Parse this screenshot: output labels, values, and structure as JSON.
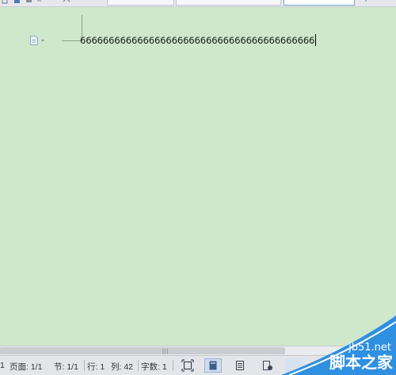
{
  "document": {
    "text": "66666666666666666666666666666666666666666"
  },
  "statusbar": {
    "page_number": "1",
    "page": "页面: 1/1",
    "section": "节: 1/1",
    "line": "行: 1",
    "column": "列: 42",
    "word_count": "字数: 1"
  },
  "watermark": {
    "site": "jb51.net",
    "name": "脚本之家"
  },
  "colors": {
    "page_background": "#cfe8cc",
    "status_bar": "#e3e5e8",
    "watermark_blue": "#2f8fe0"
  },
  "icons": {
    "paragraph": "paste-doc-icon",
    "full-screen": "full-screen-icon",
    "page-view": "page-view-icon",
    "outline-view": "outline-view-icon",
    "reading-view": "reading-view-icon"
  }
}
